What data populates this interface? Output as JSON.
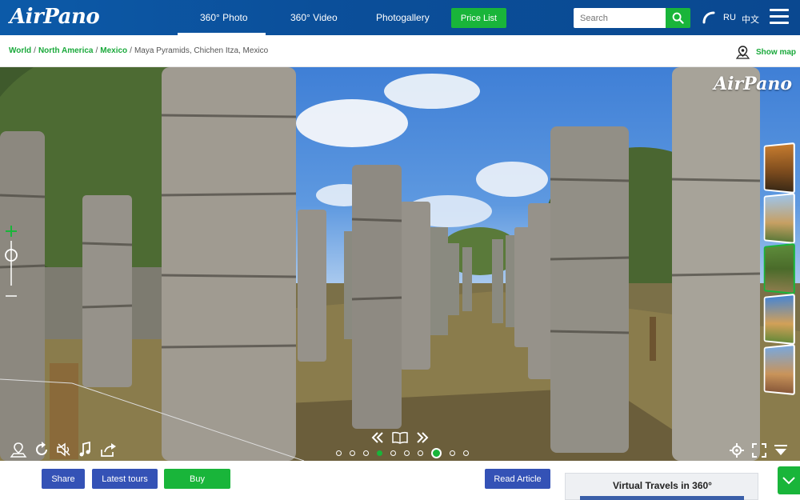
{
  "header": {
    "logo": "AirPano",
    "nav": [
      {
        "label": "360° Photo",
        "active": true
      },
      {
        "label": "360° Video",
        "active": false
      },
      {
        "label": "Photogallery",
        "active": false
      }
    ],
    "price_list": "Price List",
    "search_placeholder": "Search",
    "languages": [
      "RU",
      "中文"
    ]
  },
  "breadcrumb": {
    "links": [
      "World",
      "North America",
      "Mexico"
    ],
    "current": "Maya Pyramids, Chichen Itza, Mexico",
    "show_map": "Show map"
  },
  "panorama": {
    "watermark": "AirPano",
    "controls_left": [
      "location-pin-icon",
      "rotate-icon",
      "mute-icon",
      "music-icon",
      "share-icon"
    ],
    "controls_right": [
      "settings-icon",
      "fullscreen-icon",
      "hide-controls-icon"
    ],
    "dots_count": 10,
    "active_dot": 7,
    "visited_dot": 4
  },
  "bottom": {
    "share": "Share",
    "latest_tours": "Latest tours",
    "buy": "Buy",
    "read_article": "Read Article",
    "virtual_travels": "Virtual Travels in 360°"
  },
  "colors": {
    "header_blue": "#0b4f9a",
    "accent_green": "#19b53a",
    "button_blue": "#3452b6"
  }
}
